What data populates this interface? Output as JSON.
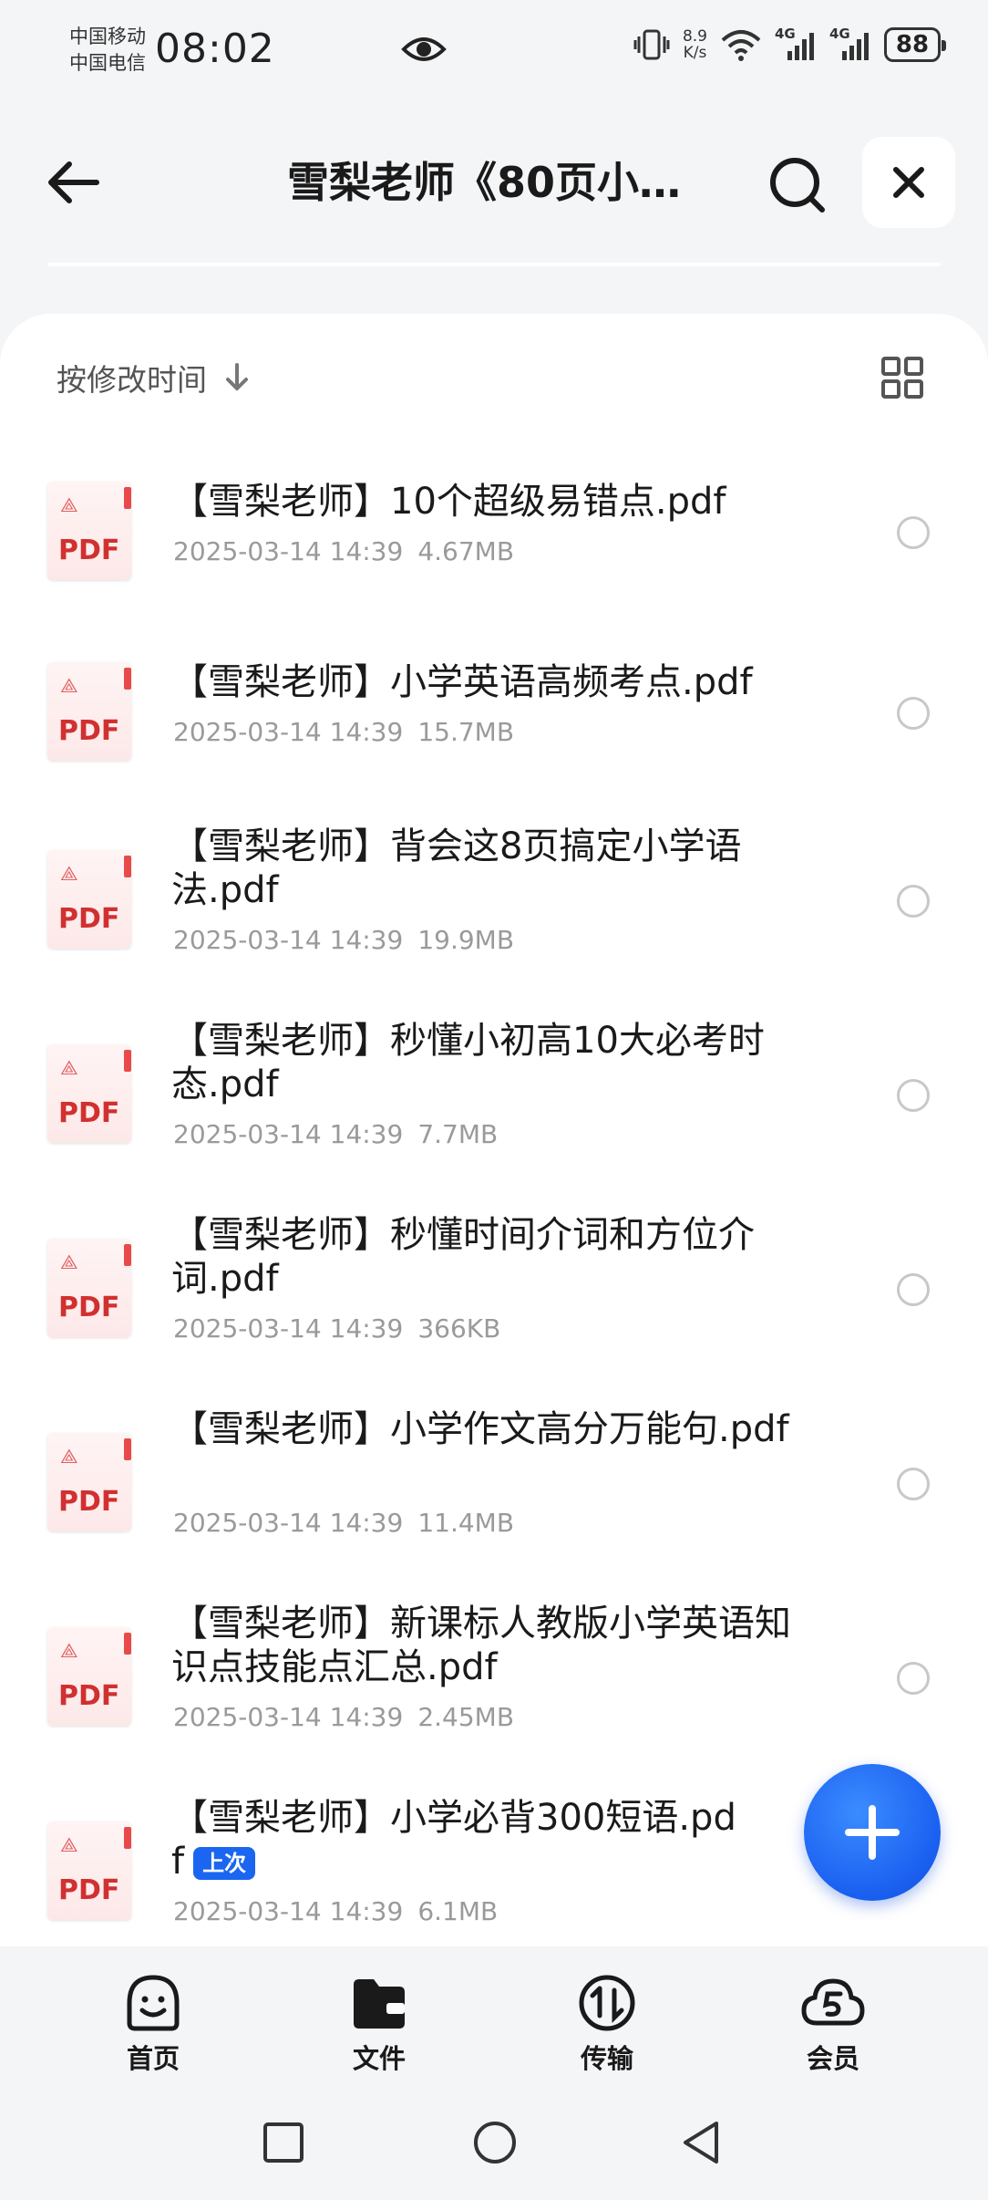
{
  "status_bar": {
    "carrier1": "中国移动",
    "carrier2": "中国电信",
    "time": "08:02",
    "speed_value": "8.9",
    "speed_unit": "K/s",
    "network1": "4G",
    "network2": "4G",
    "battery": "88"
  },
  "header": {
    "title": "雪梨老师《80页小…"
  },
  "sort": {
    "label": "按修改时间"
  },
  "files": [
    {
      "name": "【雪梨老师】10个超级易错点.pdf",
      "date": "2025-03-14 14:39",
      "size": "4.67MB",
      "badge": ""
    },
    {
      "name": "【雪梨老师】小学英语高频考点.pdf",
      "date": "2025-03-14 14:39",
      "size": "15.7MB",
      "badge": ""
    },
    {
      "name": "【雪梨老师】背会这8页搞定小学语法.pdf",
      "date": "2025-03-14 14:39",
      "size": "19.9MB",
      "badge": ""
    },
    {
      "name": "【雪梨老师】秒懂小初高10大必考时态.pdf",
      "date": "2025-03-14 14:39",
      "size": "7.7MB",
      "badge": ""
    },
    {
      "name": "【雪梨老师】秒懂时间介词和方位介词.pdf",
      "date": "2025-03-14 14:39",
      "size": "366KB",
      "badge": ""
    },
    {
      "name": "【雪梨老师】小学作文高分万能句.pdf",
      "date": "2025-03-14 14:39",
      "size": "11.4MB",
      "badge": ""
    },
    {
      "name": "【雪梨老师】新课标人教版小学英语知识点技能点汇总.pdf",
      "date": "2025-03-14 14:39",
      "size": "2.45MB",
      "badge": ""
    },
    {
      "name": "【雪梨老师】小学必背300短语.pdf",
      "date": "2025-03-14 14:39",
      "size": "6.1MB",
      "badge": "上次"
    }
  ],
  "file_icon_label": "PDF",
  "bottom_nav": [
    {
      "label": "首页",
      "icon": "smile-home-icon"
    },
    {
      "label": "文件",
      "icon": "folder-icon"
    },
    {
      "label": "传输",
      "icon": "transfer-icon"
    },
    {
      "label": "会员",
      "icon": "cloud-vip-icon"
    }
  ],
  "colors": {
    "accent": "#1a66f0",
    "pdf_red": "#d13030",
    "background": "#f4f5f7"
  }
}
